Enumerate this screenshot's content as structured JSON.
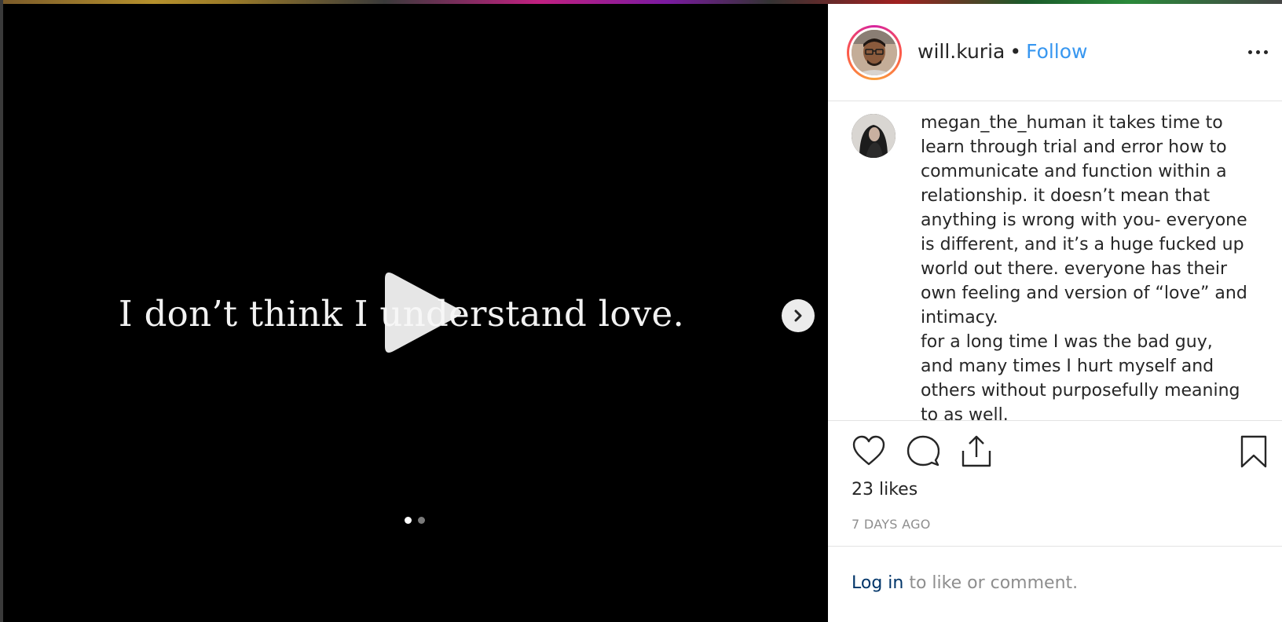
{
  "media": {
    "caption": "I don’t think I understand love.",
    "carousel_total": 2,
    "carousel_active": 1
  },
  "post": {
    "owner": "will.kuria",
    "separator": "•",
    "follow_label": "Follow"
  },
  "comment": {
    "username": "megan_the_human",
    "text": "it takes time to learn through trial and error how to communicate and function within a relationship. it doesn’t mean that anything is wrong with you- everyone is different, and it’s a huge fucked up world out there. everyone has their own feeling and version of “love” and intimacy.",
    "text2": "for a long time I was the bad guy, and many times I hurt myself and others without purposefully meaning to as well."
  },
  "stats": {
    "likes": "23 likes",
    "age": "7 DAYS AGO"
  },
  "footer": {
    "login_label": "Log in",
    "login_suffix": " to like or comment."
  },
  "colors": {
    "follow": "#3897f0",
    "login": "#003569",
    "muted": "#8e8e8e"
  },
  "icons": [
    "play-icon",
    "chevron-right-icon",
    "more-icon",
    "heart-icon",
    "comment-icon",
    "share-icon",
    "bookmark-icon"
  ]
}
